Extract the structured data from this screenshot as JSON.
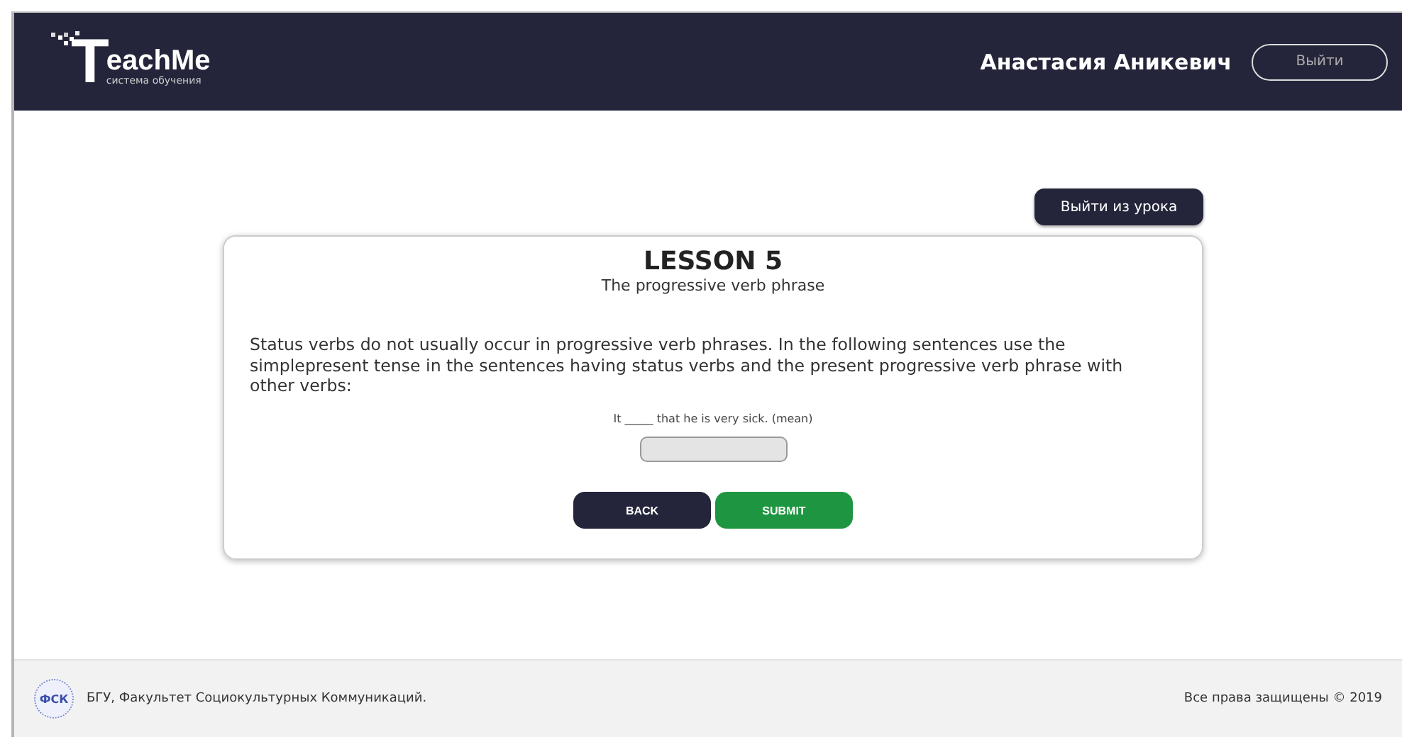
{
  "header": {
    "logo": {
      "letter": "T",
      "name": "eachMe",
      "tagline": "система обучения"
    },
    "user_name": "Анастасия Аникевич",
    "logout_button": "Выйти"
  },
  "exit_lesson_button": "Выйти из урока",
  "lesson": {
    "title": "LESSON 5",
    "subtitle": "The progressive verb phrase",
    "instructions": "Status verbs do not usually occur in progressive verb phrases. In the following sentences use the simplepresent tense in the sentences having status verbs and the present progressive verb phrase with other verbs:",
    "sentence": "It _____ that he is very sick. (mean)",
    "buttons": [
      {
        "kind": "back",
        "label": "BACK"
      },
      {
        "kind": "submit",
        "label": "SUBMIT"
      }
    ]
  },
  "footer": {
    "logo_text": "ФСК",
    "organization": "БГУ, Факультет Социокультурных Коммуникаций.",
    "copyright": "Все права защищены © 2019"
  }
}
